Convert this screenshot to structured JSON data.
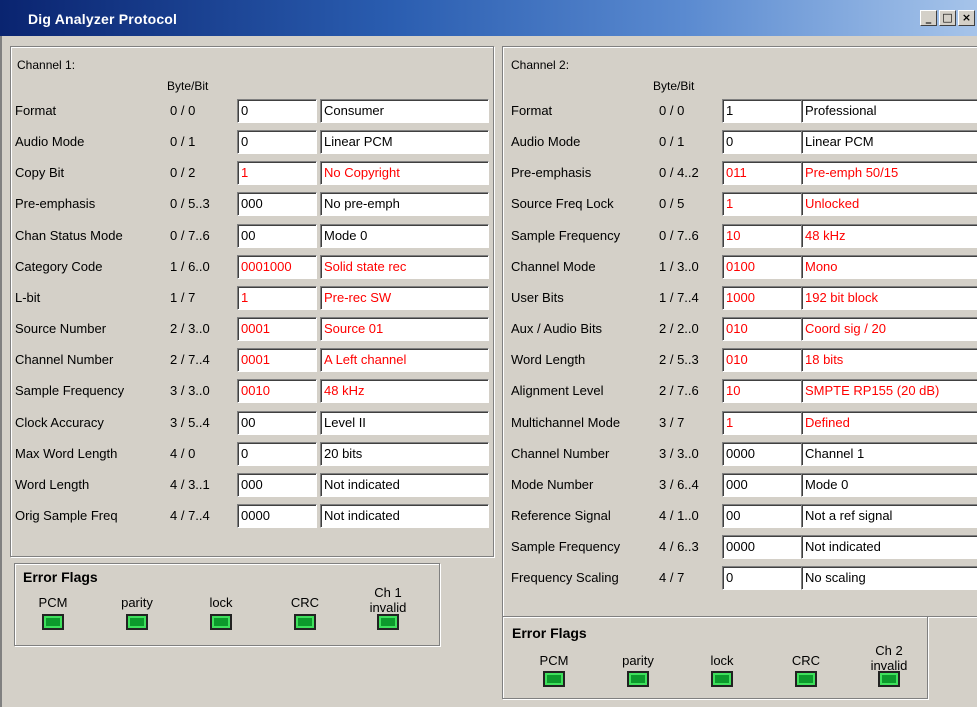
{
  "window": {
    "title": "Dig Analyzer Protocol",
    "buttons": [
      "_",
      "□",
      "×"
    ]
  },
  "ch1": {
    "title": "Channel 1:",
    "bytebit_header": "Byte/Bit",
    "rows": [
      {
        "label": "Format",
        "bb": "0 / 0",
        "val": "0",
        "desc": "Consumer",
        "red": false
      },
      {
        "label": "Audio Mode",
        "bb": "0 / 1",
        "val": "0",
        "desc": "Linear PCM",
        "red": false
      },
      {
        "label": "Copy Bit",
        "bb": "0 / 2",
        "val": "1",
        "desc": "No Copyright",
        "red": true
      },
      {
        "label": "Pre-emphasis",
        "bb": "0 / 5..3",
        "val": "000",
        "desc": "No pre-emph",
        "red": false
      },
      {
        "label": "Chan Status Mode",
        "bb": "0 / 7..6",
        "val": "00",
        "desc": "Mode 0",
        "red": false
      },
      {
        "label": "Category Code",
        "bb": "1 / 6..0",
        "val": "0001000",
        "desc": "Solid state rec",
        "red": true
      },
      {
        "label": "L-bit",
        "bb": "1 / 7",
        "val": "1",
        "desc": "Pre-rec SW",
        "red": true
      },
      {
        "label": "Source Number",
        "bb": "2 / 3..0",
        "val": "0001",
        "desc": "Source 01",
        "red": true
      },
      {
        "label": "Channel Number",
        "bb": "2 / 7..4",
        "val": "0001",
        "desc": "A Left channel",
        "red": true
      },
      {
        "label": "Sample Frequency",
        "bb": "3 / 3..0",
        "val": "0010",
        "desc": "48 kHz",
        "red": true
      },
      {
        "label": "Clock Accuracy",
        "bb": "3 / 5..4",
        "val": "00",
        "desc": "Level II",
        "red": false
      },
      {
        "label": "Max Word Length",
        "bb": "4 / 0",
        "val": "0",
        "desc": "20 bits",
        "red": false
      },
      {
        "label": " Word Length",
        "bb": "4 / 3..1",
        "val": "000",
        "desc": "Not indicated",
        "red": false
      },
      {
        "label": "Orig Sample Freq",
        "bb": "4 / 7..4",
        "val": "0000",
        "desc": "Not indicated",
        "red": false
      }
    ]
  },
  "ch2": {
    "title": "Channel 2:",
    "bytebit_header": "Byte/Bit",
    "rows": [
      {
        "label": "Format",
        "bb": "0 / 0",
        "val": "1",
        "desc": "Professional",
        "red": false
      },
      {
        "label": "Audio Mode",
        "bb": "0 / 1",
        "val": "0",
        "desc": "Linear PCM",
        "red": false
      },
      {
        "label": "Pre-emphasis",
        "bb": "0 / 4..2",
        "val": "011",
        "desc": "Pre-emph 50/15",
        "red": true
      },
      {
        "label": "Source Freq Lock",
        "bb": "0 / 5",
        "val": "1",
        "desc": "Unlocked",
        "red": true
      },
      {
        "label": "Sample Frequency",
        "bb": "0 / 7..6",
        "val": "10",
        "desc": "48 kHz",
        "red": true
      },
      {
        "label": "Channel Mode",
        "bb": "1 / 3..0",
        "val": "0100",
        "desc": "Mono",
        "red": true
      },
      {
        "label": "User Bits",
        "bb": "1 / 7..4",
        "val": "1000",
        "desc": "192 bit block",
        "red": true
      },
      {
        "label": "Aux / Audio Bits",
        "bb": "2 / 2..0",
        "val": "010",
        "desc": "Coord sig / 20",
        "red": true
      },
      {
        "label": " Word Length",
        "bb": "2 / 5..3",
        "val": "010",
        "desc": "18 bits",
        "red": true
      },
      {
        "label": "Alignment Level",
        "bb": "2 / 7..6",
        "val": "10",
        "desc": "SMPTE RP155 (20 dB)",
        "red": true
      },
      {
        "label": "Multichannel Mode",
        "bb": "3 / 7",
        "val": "1",
        "desc": "Defined",
        "red": true
      },
      {
        "label": "Channel Number",
        "bb": "3 / 3..0",
        "val": "0000",
        "desc": "Channel 1",
        "red": false
      },
      {
        "label": "Mode Number",
        "bb": "3 / 6..4",
        "val": "000",
        "desc": "Mode 0",
        "red": false
      },
      {
        "label": "Reference Signal",
        "bb": "4 / 1..0",
        "val": "00",
        "desc": "Not a ref signal",
        "red": false
      },
      {
        "label": "Sample Frequency",
        "bb": "4 / 6..3",
        "val": "0000",
        "desc": "Not indicated",
        "red": false
      },
      {
        "label": "Frequency Scaling",
        "bb": "4 / 7",
        "val": "0",
        "desc": "No scaling",
        "red": false
      }
    ]
  },
  "errflags1": {
    "title": "Error Flags",
    "labels": [
      "PCM",
      "parity",
      "lock",
      "CRC",
      "Ch 1\ninvalid"
    ]
  },
  "errflags2": {
    "title": "Error Flags",
    "labels": [
      "PCM",
      "parity",
      "lock",
      "CRC",
      "Ch 2\ninvalid"
    ]
  },
  "colors": {
    "title_start": "#0a2470",
    "title_end": "#a6c4ea",
    "led": "#0c9a2c",
    "red_text": "#ff0000",
    "face": "#d4d0c8"
  }
}
